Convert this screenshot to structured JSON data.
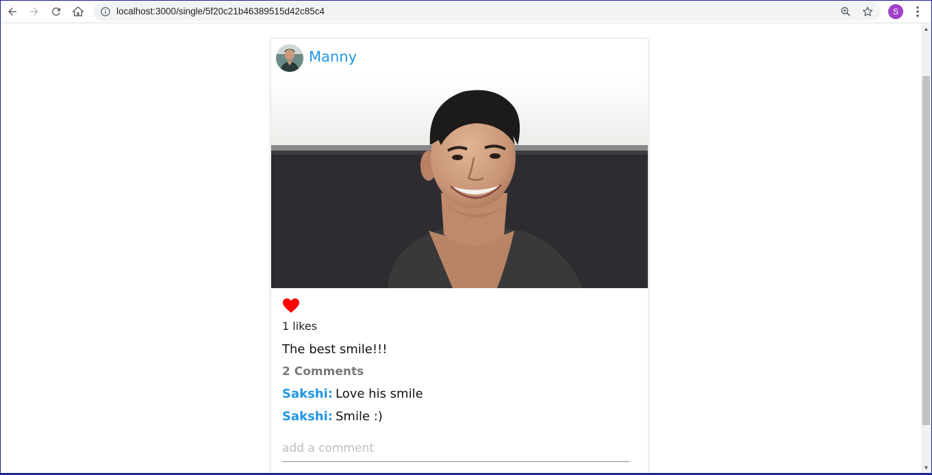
{
  "browser": {
    "url": "localhost:3000/single/5f20c21b46389515d42c85c4",
    "profile_initial": "S",
    "colors": {
      "profile": "#a142c9"
    }
  },
  "post": {
    "author": "Manny",
    "likes_text": "1 likes",
    "liked": true,
    "caption": "The best smile!!!",
    "comments_count_text": "2 Comments",
    "comments": [
      {
        "user": "Sakshi:",
        "text": "Love his smile"
      },
      {
        "user": "Sakshi:",
        "text": "Smile :)"
      }
    ],
    "comment_placeholder": "add a comment",
    "colors": {
      "accent": "#2196e6",
      "heart": "#ff0000"
    }
  }
}
